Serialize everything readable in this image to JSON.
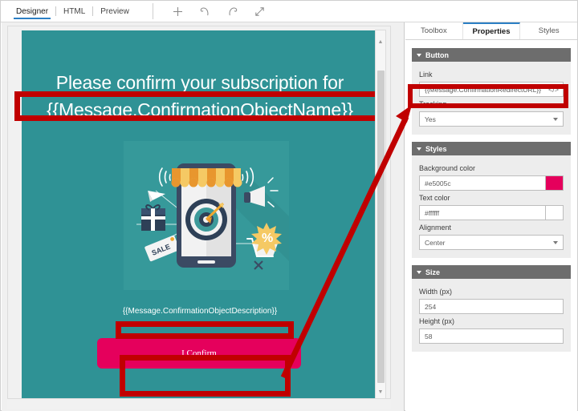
{
  "toolbar": {
    "tabs": [
      {
        "label": "Designer",
        "active": true
      },
      {
        "label": "HTML",
        "active": false
      },
      {
        "label": "Preview",
        "active": false
      }
    ],
    "actions": [
      {
        "name": "add-icon",
        "label": "+"
      },
      {
        "name": "undo-icon",
        "label": "Undo"
      },
      {
        "name": "redo-icon",
        "label": "Redo"
      },
      {
        "name": "expand-icon",
        "label": "Expand"
      }
    ]
  },
  "canvas": {
    "background_color": "#2f9295",
    "headline_line1": "Please confirm your subscription for",
    "headline_line2": "{{Message.ConfirmationObjectName}}",
    "description": "{{Message.ConfirmationObjectDescription}}",
    "button_label": "I Confirm",
    "button_color": "#e5005c",
    "illustration_name": "mobile-marketing-illustration"
  },
  "panel": {
    "tabs": [
      {
        "label": "Toolbox",
        "active": false
      },
      {
        "label": "Properties",
        "active": true
      },
      {
        "label": "Styles",
        "active": false
      }
    ],
    "sections": {
      "button": {
        "title": "Button",
        "link_label": "Link",
        "link_value": "{{Message.ConfirmationRedirectURL}}",
        "code_icon": "</>",
        "tracking_label": "Tracking",
        "tracking_value": "Yes"
      },
      "styles": {
        "title": "Styles",
        "background_color_label": "Background color",
        "background_color_value": "#e5005c",
        "text_color_label": "Text color",
        "text_color_value": "#ffffff",
        "alignment_label": "Alignment",
        "alignment_value": "Center"
      },
      "size": {
        "title": "Size",
        "width_label": "Width (px)",
        "width_value": "254",
        "height_label": "Height (px)",
        "height_value": "58"
      }
    }
  },
  "annotations": {
    "highlight_color": "#c00000",
    "arrow_name": "button-to-link-arrow"
  }
}
